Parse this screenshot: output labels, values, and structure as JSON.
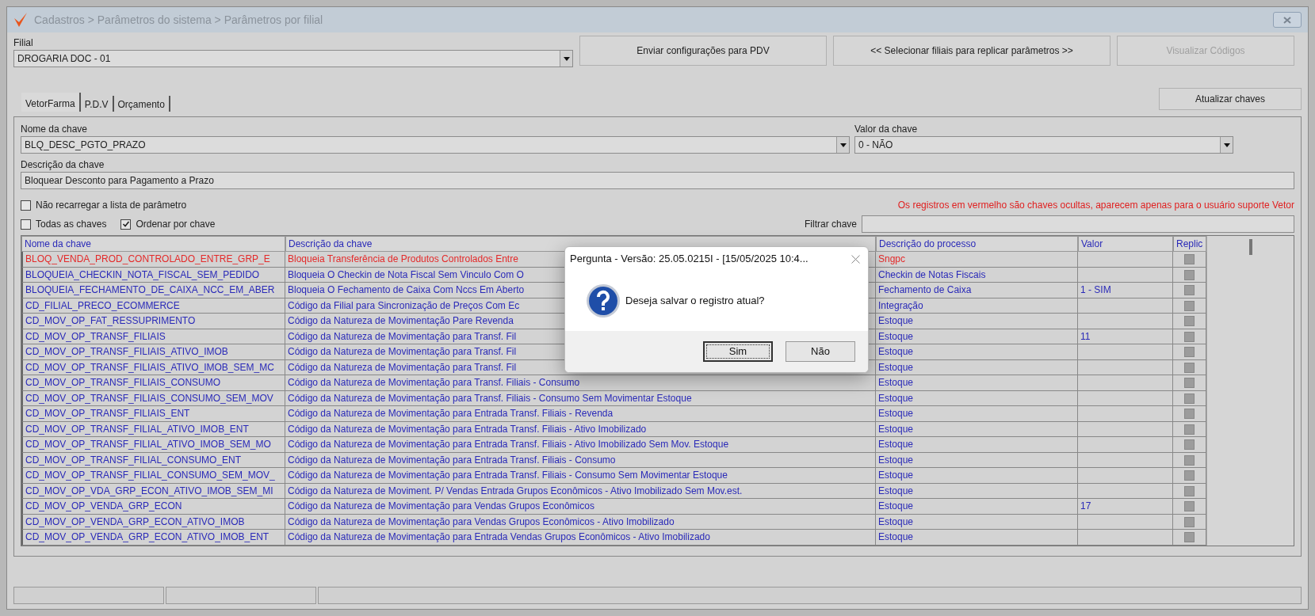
{
  "window": {
    "title": "Cadastros > Parâmetros do sistema > Parâmetros por filial"
  },
  "filial": {
    "label": "Filial",
    "value": "DROGARIA DOC - 01"
  },
  "top_buttons": [
    {
      "label": "Enviar configurações para  PDV",
      "disabled": false
    },
    {
      "label": "<< Selecionar filiais para replicar parâmetros >>",
      "disabled": false
    },
    {
      "label": "Visualizar Códigos",
      "disabled": true
    }
  ],
  "tabs": [
    {
      "label": "VetorFarma",
      "selected": true
    },
    {
      "label": "P.D.V",
      "selected": false
    },
    {
      "label": "Orçamento",
      "selected": false
    }
  ],
  "refresh_button": "Atualizar chaves",
  "key_name": {
    "label": "Nome da chave",
    "value": "BLQ_DESC_PGTO_PRAZO"
  },
  "key_value": {
    "label": "Valor da chave",
    "value": "0 - NÃO"
  },
  "key_description": {
    "label": "Descrição da chave",
    "value": "Bloquear Desconto para Pagamento a Prazo"
  },
  "options": [
    {
      "label": "Não recarregar a lista de parâmetro",
      "checked": false
    },
    {
      "label": "Todas as chaves",
      "checked": false
    },
    {
      "label": "Ordenar por chave",
      "checked": true
    }
  ],
  "hidden_note": "Os registros em vermelho são chaves ocultas, aparecem apenas para o usuário suporte Vetor",
  "filter": {
    "label": "Filtrar chave"
  },
  "table": {
    "columns": [
      "Nome da chave",
      "Descrição  da chave",
      "Descrição do processo",
      "Valor",
      "Replic"
    ],
    "rows": [
      {
        "name": "BLOQ_VENDA_PROD_CONTROLADO_ENTRE_GRP_E",
        "description": "Bloqueia Transferência de Produtos Controlados Entre",
        "process": "Sngpc",
        "value": "",
        "hidden_key": true
      },
      {
        "name": "BLOQUEIA_CHECKIN_NOTA_FISCAL_SEM_PEDIDO",
        "description": "Bloqueia O Checkin de Nota Fiscal Sem Vinculo Com O",
        "process": "Checkin de Notas Fiscais",
        "value": "",
        "hidden_key": false
      },
      {
        "name": "BLOQUEIA_FECHAMENTO_DE_CAIXA_NCC_EM_ABER",
        "description": "Bloqueia O Fechamento de Caixa Com Nccs Em Aberto",
        "process": "Fechamento de Caixa",
        "value": "1 - SIM",
        "hidden_key": false
      },
      {
        "name": "CD_FILIAL_PRECO_ECOMMERCE",
        "description": "Código da Filial para Sincronização de Preços Com Ec",
        "process": "Integração",
        "value": "",
        "hidden_key": false
      },
      {
        "name": "CD_MOV_OP_FAT_RESSUPRIMENTO",
        "description": "Código da Natureza de Movimentação Pare Revenda",
        "process": "Estoque",
        "value": "",
        "hidden_key": false
      },
      {
        "name": "CD_MOV_OP_TRANSF_FILIAIS",
        "description": "Código da Natureza de Movimentação para Transf. Fil",
        "process": "Estoque",
        "value": "11",
        "hidden_key": false
      },
      {
        "name": "CD_MOV_OP_TRANSF_FILIAIS_ATIVO_IMOB",
        "description": "Código da Natureza de Movimentação para Transf. Fil",
        "process": "Estoque",
        "value": "",
        "hidden_key": false
      },
      {
        "name": "CD_MOV_OP_TRANSF_FILIAIS_ATIVO_IMOB_SEM_MC",
        "description": "Código da Natureza de Movimentação para Transf. Fil",
        "process": "Estoque",
        "value": "",
        "hidden_key": false
      },
      {
        "name": "CD_MOV_OP_TRANSF_FILIAIS_CONSUMO",
        "description": "Código da Natureza de Movimentação para Transf. Filiais - Consumo",
        "process": "Estoque",
        "value": "",
        "hidden_key": false
      },
      {
        "name": "CD_MOV_OP_TRANSF_FILIAIS_CONSUMO_SEM_MOV",
        "description": "Código da Natureza de Movimentação para Transf. Filiais - Consumo Sem Movimentar Estoque",
        "process": "Estoque",
        "value": "",
        "hidden_key": false
      },
      {
        "name": "CD_MOV_OP_TRANSF_FILIAIS_ENT",
        "description": "Código da Natureza de Movimentação para Entrada Transf. Filiais - Revenda",
        "process": "Estoque",
        "value": "",
        "hidden_key": false
      },
      {
        "name": "CD_MOV_OP_TRANSF_FILIAL_ATIVO_IMOB_ENT",
        "description": "Código da Natureza de Movimentação para Entrada Transf. Filiais - Ativo Imobilizado",
        "process": "Estoque",
        "value": "",
        "hidden_key": false
      },
      {
        "name": "CD_MOV_OP_TRANSF_FILIAL_ATIVO_IMOB_SEM_MO",
        "description": "Código da Natureza de Movimentação para Entrada Transf. Filiais - Ativo Imobilizado Sem Mov. Estoque",
        "process": "Estoque",
        "value": "",
        "hidden_key": false
      },
      {
        "name": "CD_MOV_OP_TRANSF_FILIAL_CONSUMO_ENT",
        "description": "Código da Natureza de Movimentação para Entrada Transf. Filiais - Consumo",
        "process": "Estoque",
        "value": "",
        "hidden_key": false
      },
      {
        "name": "CD_MOV_OP_TRANSF_FILIAL_CONSUMO_SEM_MOV_",
        "description": "Código da Natureza de Movimentação para Entrada Transf. Filiais - Consumo Sem Movimentar Estoque",
        "process": "Estoque",
        "value": "",
        "hidden_key": false
      },
      {
        "name": "CD_MOV_OP_VDA_GRP_ECON_ATIVO_IMOB_SEM_MI",
        "description": "Código da Natureza de Moviment. P/ Vendas Entrada Grupos Econômicos - Ativo Imobilizado Sem Mov.est.",
        "process": "Estoque",
        "value": "",
        "hidden_key": false
      },
      {
        "name": "CD_MOV_OP_VENDA_GRP_ECON",
        "description": "Código da Natureza de Movimentação para Vendas Grupos Econômicos",
        "process": "Estoque",
        "value": "17",
        "hidden_key": false
      },
      {
        "name": "CD_MOV_OP_VENDA_GRP_ECON_ATIVO_IMOB",
        "description": "Código da Natureza de Movimentação para Vendas Grupos Econômicos - Ativo Imobilizado",
        "process": "Estoque",
        "value": "",
        "hidden_key": false
      },
      {
        "name": "CD_MOV_OP_VENDA_GRP_ECON_ATIVO_IMOB_ENT",
        "description": "Código da Natureza de Movimentação para Entrada Vendas Grupos Econômicos - Ativo Imobilizado",
        "process": "Estoque",
        "value": "",
        "hidden_key": false
      }
    ]
  },
  "dialog": {
    "title": "Pergunta - Versão: 25.05.0215I - [15/05/2025 10:4...",
    "message": "Deseja salvar o registro atual?",
    "buttons": [
      {
        "label": "Sim",
        "default": true
      },
      {
        "label": "Não",
        "default": false
      }
    ]
  }
}
